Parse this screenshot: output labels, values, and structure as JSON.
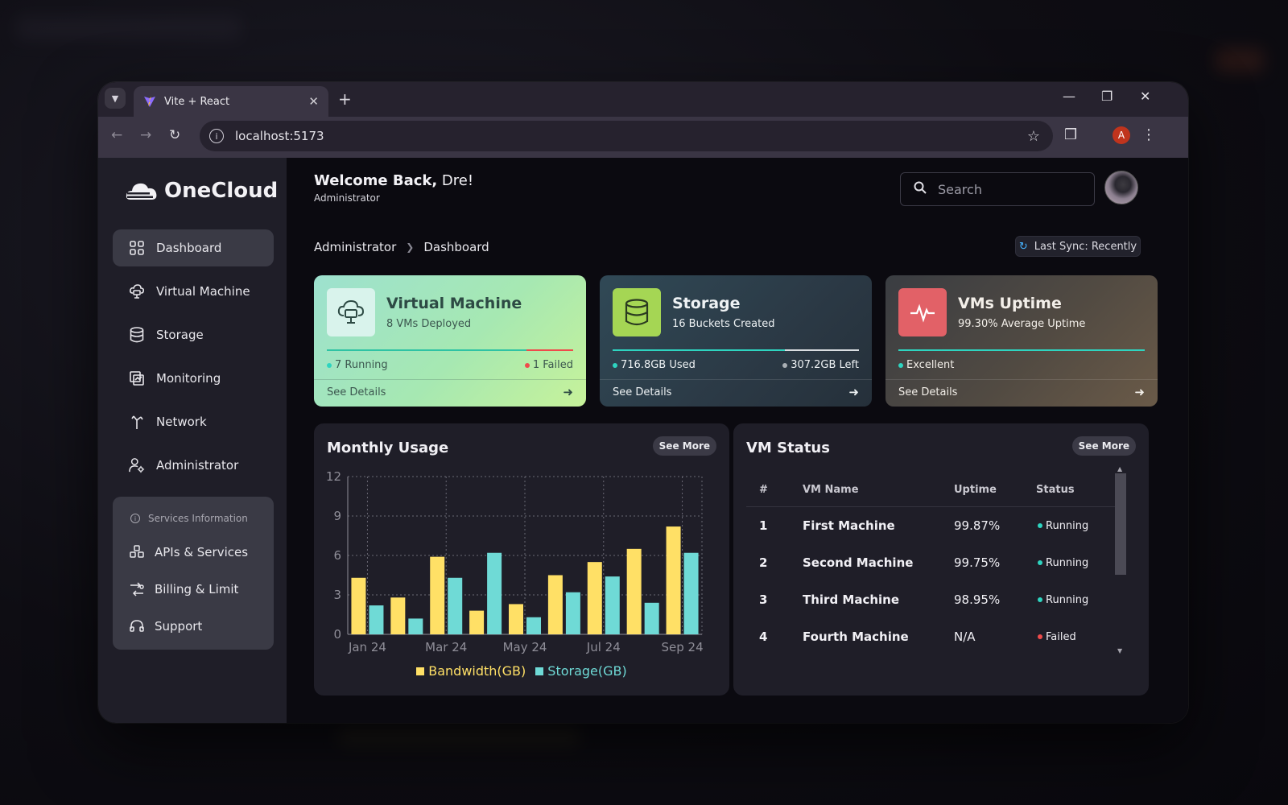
{
  "browser": {
    "tab_title": "Vite + React",
    "url": "localhost:5173",
    "profile_initial": "A"
  },
  "sidebar": {
    "brand": "OneCloud",
    "items": [
      {
        "label": "Dashboard",
        "icon": "grid-icon",
        "active": true
      },
      {
        "label": "Virtual Machine",
        "icon": "cloud-server-icon"
      },
      {
        "label": "Storage",
        "icon": "database-icon"
      },
      {
        "label": "Monitoring",
        "icon": "monitor-icon"
      },
      {
        "label": "Network",
        "icon": "network-icon"
      },
      {
        "label": "Administrator",
        "icon": "user-gear-icon"
      }
    ],
    "services_title": "Services Information",
    "services": [
      {
        "label": "APIs & Services",
        "icon": "api-icon"
      },
      {
        "label": "Billing & Limit",
        "icon": "billing-icon"
      },
      {
        "label": "Support",
        "icon": "headset-icon"
      }
    ]
  },
  "header": {
    "welcome_bold": "Welcome Back,",
    "welcome_name": " Dre!",
    "role": "Administrator",
    "search_placeholder": "Search"
  },
  "breadcrumb": {
    "root": "Administrator",
    "current": "Dashboard"
  },
  "sync_label": "Last Sync: Recently",
  "cards": [
    {
      "title": "Virtual Machine",
      "subtitle": "8 VMs Deployed",
      "stat_left": "7 Running",
      "stat_right": "1 Failed",
      "link": "See Details"
    },
    {
      "title": "Storage",
      "subtitle": "16 Buckets Created",
      "stat_left": "716.8GB Used",
      "stat_right": "307.2GB Left",
      "link": "See Details"
    },
    {
      "title": "VMs Uptime",
      "subtitle": "99.30% Average Uptime",
      "stat_left": "Excellent",
      "link": "See Details"
    }
  ],
  "monthly_usage": {
    "title": "Monthly Usage",
    "see_more": "See More"
  },
  "vm_status": {
    "title": "VM Status",
    "see_more": "See More",
    "columns": [
      "#",
      "VM Name",
      "Uptime",
      "Status"
    ],
    "rows": [
      {
        "num": "1",
        "name": "First Machine",
        "uptime": "99.87%",
        "status": "Running"
      },
      {
        "num": "2",
        "name": "Second Machine",
        "uptime": "99.75%",
        "status": "Running"
      },
      {
        "num": "3",
        "name": "Third Machine",
        "uptime": "98.95%",
        "status": "Running"
      },
      {
        "num": "4",
        "name": "Fourth Machine",
        "uptime": "N/A",
        "status": "Failed"
      }
    ]
  },
  "colors": {
    "bandwidth": "#ffe066",
    "storage": "#6fdad6",
    "running": "#2ed4c0",
    "failed": "#ef4b4b",
    "accent_sync": "#45b3ff"
  },
  "chart_data": {
    "type": "bar",
    "categories": [
      "Jan 24",
      "Feb 24",
      "Mar 24",
      "Apr 24",
      "May 24",
      "Jun 24",
      "Jul 24",
      "Aug 24",
      "Sep 24"
    ],
    "x_tick_labels": [
      "Jan 24",
      "Mar 24",
      "May 24",
      "Jul 24",
      "Sep 24"
    ],
    "series": [
      {
        "name": "Bandwidth(GB)",
        "values": [
          4.3,
          2.8,
          5.9,
          1.8,
          2.3,
          4.5,
          5.5,
          6.5,
          8.2
        ]
      },
      {
        "name": "Storage(GB)",
        "values": [
          2.2,
          1.2,
          4.3,
          6.2,
          1.3,
          3.2,
          4.4,
          2.4,
          6.2
        ]
      }
    ],
    "yticks": [
      0,
      3,
      6,
      9,
      12
    ],
    "ylim": [
      0,
      12
    ],
    "grid": true,
    "legend": "bottom"
  }
}
